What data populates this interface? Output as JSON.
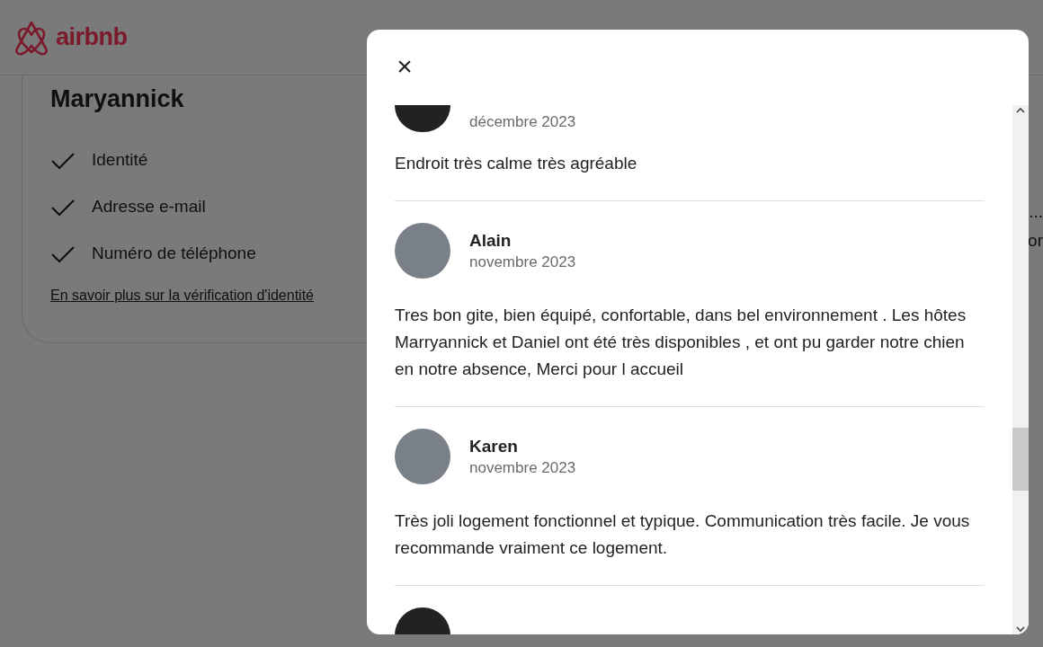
{
  "brand": {
    "name": "airbnb"
  },
  "host_card": {
    "name": "Maryannick",
    "verified": [
      {
        "label": "Identité",
        "checked": true
      },
      {
        "label": "Adresse e-mail",
        "checked": true
      },
      {
        "label": "Numéro de téléphone",
        "checked": true
      }
    ],
    "link": "En savoir plus sur la vérification d'identité"
  },
  "background_fragments": [
    "...",
    "or"
  ],
  "modal": {
    "close": "×",
    "reviews": [
      {
        "kind": "cut_top",
        "date": "décembre 2023",
        "comment": "Endroit très calme très agréable"
      },
      {
        "kind": "full",
        "name": "Alain",
        "date": "novembre 2023",
        "comment": "Tres bon gite, bien équipé, confortable, dans bel environnement . Les hôtes Marryannick et Daniel ont été très disponibles , et ont pu garder notre chien en notre absence, Merci pour l accueil"
      },
      {
        "kind": "full",
        "name": "Karen",
        "date": "novembre 2023",
        "comment": "Très joli logement fonctionnel et typique. Communication très facile. Je vous recommande vraiment ce logement."
      },
      {
        "kind": "cut_bottom"
      }
    ]
  }
}
